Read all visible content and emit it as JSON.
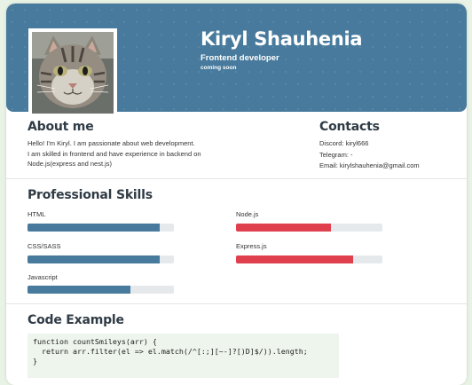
{
  "header": {
    "name": "Kiryl Shauhenia",
    "role": "Frontend developer",
    "status": "coming soon",
    "accent_color": "#477a9c"
  },
  "about": {
    "title": "About me",
    "lines": [
      "Hello! I'm Kiryl. I am passionate about web development.",
      "I am skilled in frontend and have experience in backend on",
      "Node.js(express and nest.js)"
    ]
  },
  "contacts": {
    "title": "Contacts",
    "discord": "Discord: kiryl666",
    "telegram": "Telegram: -",
    "email": "Email: kirylshauhenia@gmail.com"
  },
  "skills": {
    "title": "Professional Skills",
    "frontend": [
      {
        "name": "HTML",
        "level": 0.9,
        "color": "#477a9c"
      },
      {
        "name": "CSS/SASS",
        "level": 0.9,
        "color": "#477a9c"
      },
      {
        "name": "Javascript",
        "level": 0.7,
        "color": "#477a9c"
      }
    ],
    "backend": [
      {
        "name": "Node.js",
        "level": 0.65,
        "color": "#e0404e"
      },
      {
        "name": "Express.js",
        "level": 0.8,
        "color": "#e0404e"
      }
    ]
  },
  "code": {
    "title": "Code Example",
    "lines": [
      "function countSmileys(arr) {",
      "  return arr.filter(el => el.match(/^[:;][~-]?[)D]$/)).length;",
      "}"
    ]
  }
}
